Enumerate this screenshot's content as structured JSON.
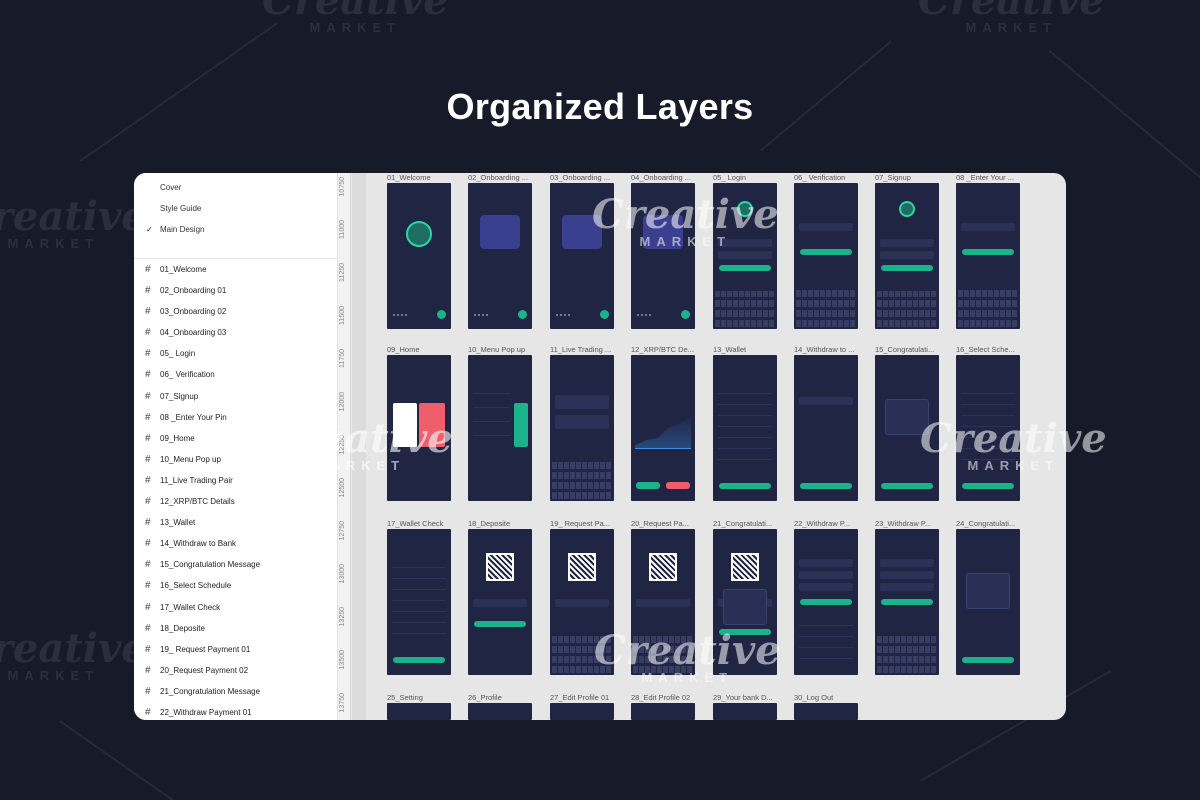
{
  "headline": "Organized Layers",
  "watermark": {
    "line1": "Creative",
    "line2": "MARKET"
  },
  "layers_panel": {
    "pages": [
      {
        "label": "Cover",
        "selected": false
      },
      {
        "label": "Style Guide",
        "selected": false
      },
      {
        "label": "Main Design",
        "selected": true
      }
    ],
    "check_icon": "✓",
    "hash_icon": "#",
    "layers": [
      "01_Welcome",
      "02_Onboarding 01",
      "03_Onboarding 02",
      "04_Onboarding 03",
      "05_ Login",
      "06_ Verification",
      "07_Signup",
      "08 _Enter Your Pin",
      "09_Home",
      "10_Menu Pop up",
      "11_Live Trading Pair",
      "12_XRP/BTC Details",
      "13_Wallet",
      "14_Withdraw to Bank",
      "15_Congratulation Message",
      "16_Select Schedule",
      "17_Wallet Check",
      "18_Deposite",
      "19_ Request Payment 01",
      "20_Request Payment 02",
      "21_Congratulation Message",
      "22_Withdraw Payment 01"
    ]
  },
  "ruler_ticks": [
    "10750",
    "11000",
    "11250",
    "11500",
    "11750",
    "12000",
    "12250",
    "12500",
    "12750",
    "13000",
    "13250",
    "13500",
    "13750"
  ],
  "frames": [
    {
      "label": "01_Welcome",
      "kind": "welcome",
      "title": "Viper"
    },
    {
      "label": "02_Onboarding ...",
      "kind": "onboard",
      "title": "We help you manage your balance"
    },
    {
      "label": "03_Onboarding ...",
      "kind": "onboard",
      "title": "Statistical Analysis of the Exchange Rate"
    },
    {
      "label": "04_Onboarding ...",
      "kind": "onboard",
      "title": "Your Currency is Safe & Security is Close"
    },
    {
      "label": "05_ Login",
      "kind": "login",
      "title": "Welcome Back"
    },
    {
      "label": "06_ Verification",
      "kind": "verify",
      "title": "Enter your code"
    },
    {
      "label": "07_Signup",
      "kind": "login",
      "title": "Get Started"
    },
    {
      "label": "08 _Enter Your ...",
      "kind": "verify",
      "title": "Enter Pin"
    },
    {
      "label": "09_Home",
      "kind": "home",
      "title": "Good morning, spend positively to everyone"
    },
    {
      "label": "10_Menu Pop up",
      "kind": "menu",
      "title": ""
    },
    {
      "label": "11_Live Trading ...",
      "kind": "trading",
      "title": "Live Trading Pair"
    },
    {
      "label": "12_XRP/BTC De...",
      "kind": "chart",
      "title": "XRP/BTC"
    },
    {
      "label": "13_Wallet",
      "kind": "wallet",
      "title": "Wallet"
    },
    {
      "label": "14_Withdraw to ...",
      "kind": "withdraw",
      "title": "Withdraw to Bank"
    },
    {
      "label": "15_Congratulati...",
      "kind": "congrats",
      "title": "Congrats"
    },
    {
      "label": "16_Select Sche...",
      "kind": "wallet",
      "title": "Wallet"
    },
    {
      "label": "17_Wallet Check",
      "kind": "walletcheck",
      "title": "$2069.03"
    },
    {
      "label": "18_Deposite",
      "kind": "qr",
      "title": "Request Payment"
    },
    {
      "label": "19_ Request Pa...",
      "kind": "qrkb",
      "title": "Request Payment"
    },
    {
      "label": "20_Request Pa...",
      "kind": "qrkb",
      "title": "Request Payment"
    },
    {
      "label": "21_Congratulati...",
      "kind": "qrpop",
      "title": "Congrats"
    },
    {
      "label": "22_Withdraw P...",
      "kind": "withdrawp",
      "title": "Withdraw Payment"
    },
    {
      "label": "23_Withdraw P...",
      "kind": "withdrawkb",
      "title": "Withdraw Payment"
    },
    {
      "label": "24_Congratulati...",
      "kind": "congrats",
      "title": "Congrats"
    },
    {
      "label": "25_Setting",
      "kind": "short",
      "title": ""
    },
    {
      "label": "26_Profile",
      "kind": "short",
      "title": ""
    },
    {
      "label": "27_Edit Profile 01",
      "kind": "short",
      "title": ""
    },
    {
      "label": "28_Edit Profile 02",
      "kind": "short",
      "title": ""
    },
    {
      "label": "29_Your bank D...",
      "kind": "short",
      "title": ""
    },
    {
      "label": "30_Log Out",
      "kind": "short",
      "title": ""
    }
  ]
}
